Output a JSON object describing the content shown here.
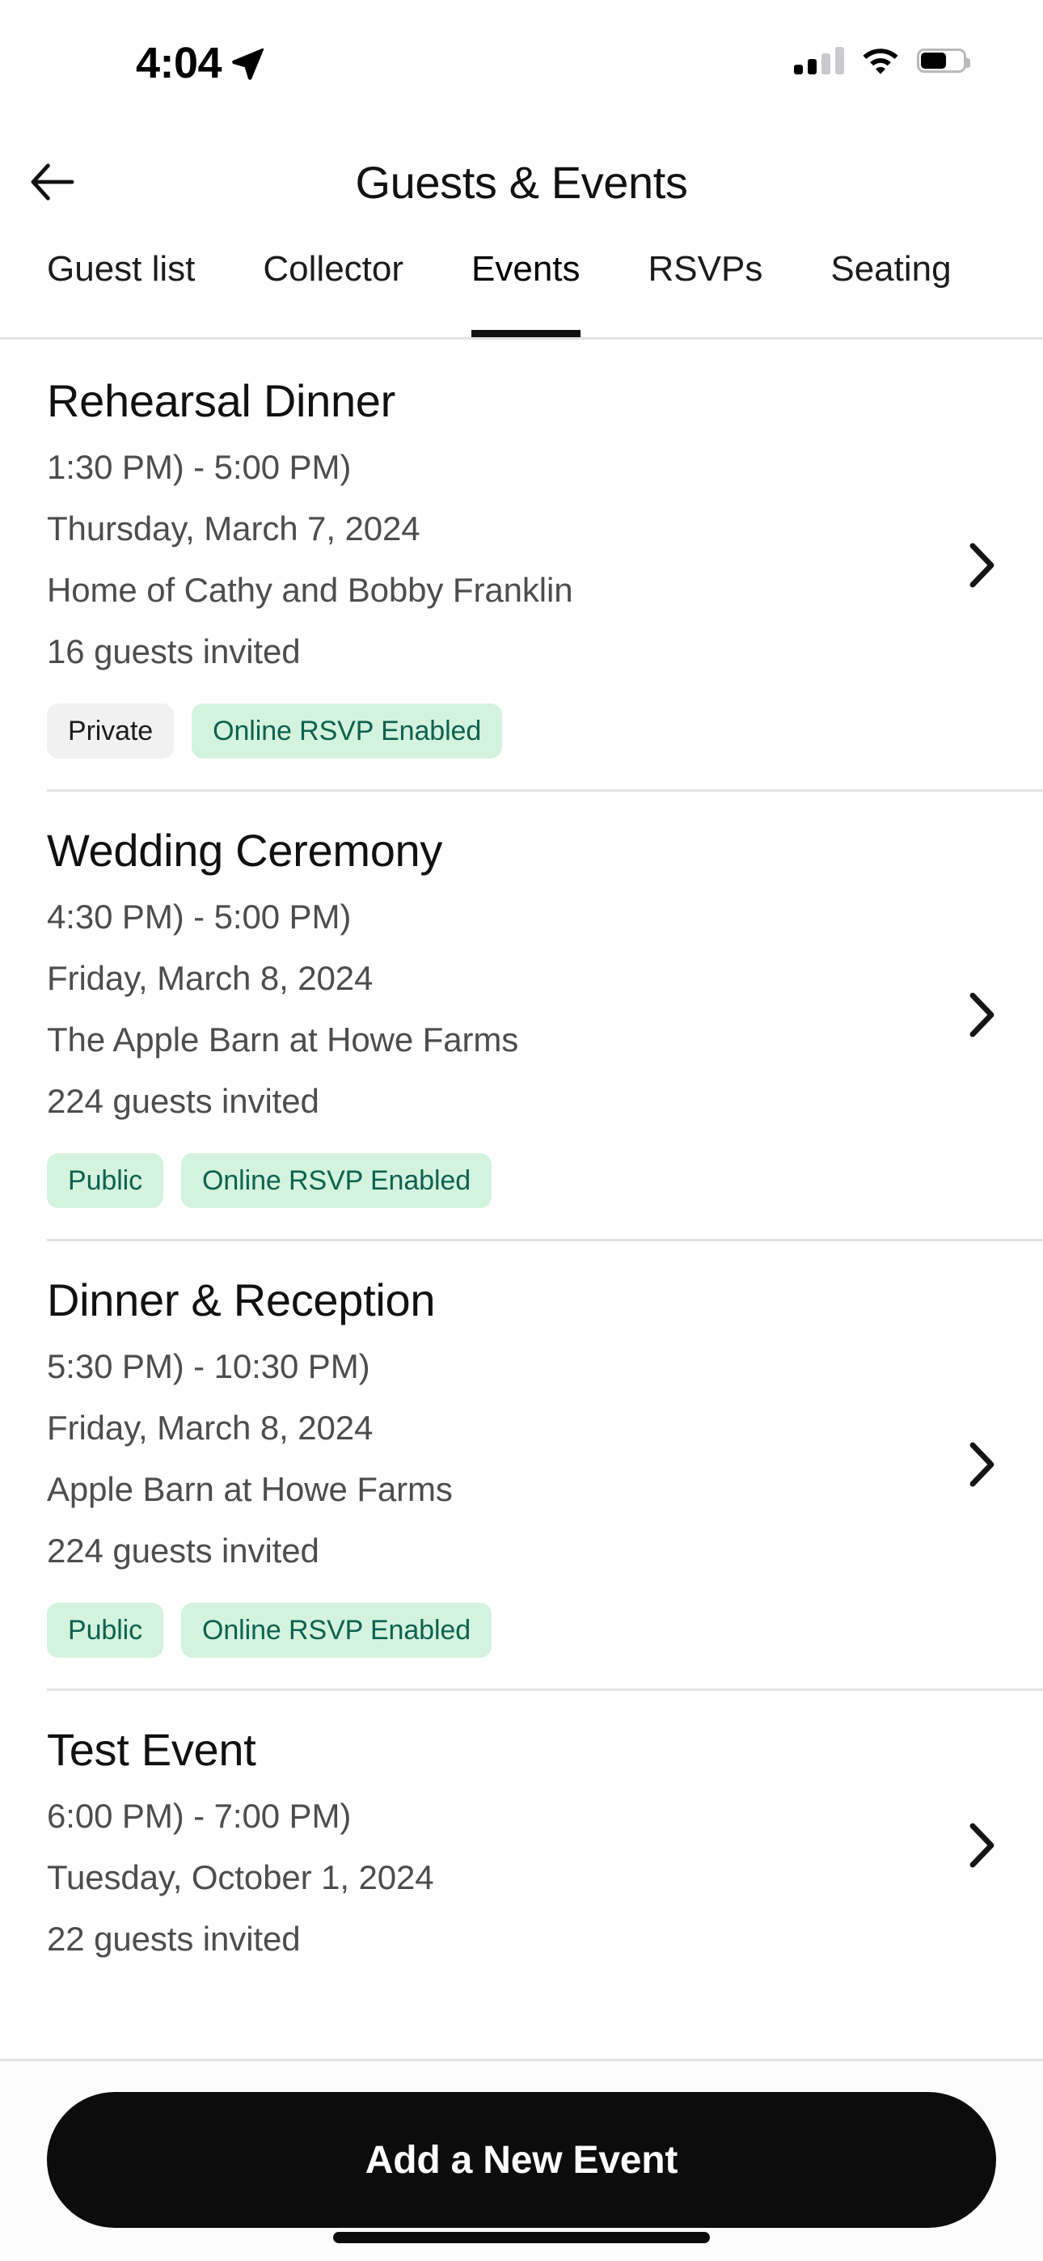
{
  "status_bar": {
    "time": "4:04",
    "location_icon": "location-arrow-icon",
    "signal_icon": "cellular-signal-icon",
    "signal_bars_filled": 2,
    "signal_bars_total": 4,
    "wifi_icon": "wifi-icon",
    "battery_icon": "battery-icon",
    "battery_level_percent": 60
  },
  "header": {
    "back_icon": "arrow-left-icon",
    "title": "Guests & Events"
  },
  "tabs": {
    "active": "Events",
    "items": [
      {
        "label": "Guest list"
      },
      {
        "label": "Collector"
      },
      {
        "label": "Events"
      },
      {
        "label": "RSVPs"
      },
      {
        "label": "Seating"
      }
    ]
  },
  "events": [
    {
      "title": "Rehearsal Dinner",
      "time": "1:30 PM) - 5:00 PM)",
      "date": "Thursday, March 7, 2024",
      "location": "Home of Cathy and Bobby Franklin",
      "guests": "16 guests invited",
      "badges": [
        {
          "label": "Private",
          "style": "neutral"
        },
        {
          "label": "Online RSVP Enabled",
          "style": "green"
        }
      ],
      "chevron_icon": "chevron-right-icon"
    },
    {
      "title": "Wedding Ceremony",
      "time": "4:30 PM) - 5:00 PM)",
      "date": "Friday, March 8, 2024",
      "location": "The Apple Barn at Howe Farms",
      "guests": "224 guests invited",
      "badges": [
        {
          "label": "Public",
          "style": "green"
        },
        {
          "label": "Online RSVP Enabled",
          "style": "green"
        }
      ],
      "chevron_icon": "chevron-right-icon"
    },
    {
      "title": "Dinner & Reception",
      "time": "5:30 PM) - 10:30 PM)",
      "date": "Friday, March 8, 2024",
      "location": "Apple Barn at Howe Farms",
      "guests": "224 guests invited",
      "badges": [
        {
          "label": "Public",
          "style": "green"
        },
        {
          "label": "Online RSVP Enabled",
          "style": "green"
        }
      ],
      "chevron_icon": "chevron-right-icon"
    },
    {
      "title": "Test Event",
      "time": "6:00 PM) - 7:00 PM)",
      "date": "Tuesday, October 1, 2024",
      "location": null,
      "guests": "22 guests invited",
      "badges": [],
      "chevron_icon": "chevron-right-icon"
    }
  ],
  "bottom_bar": {
    "cta_label": "Add a New Event",
    "home_indicator": "home-indicator"
  },
  "colors": {
    "accent": "#0c0c0c",
    "badge_green_bg": "#d4f3de",
    "badge_green_text": "#0d6150",
    "badge_neutral_bg": "#f1f1f1",
    "divider": "#e2e2e2",
    "secondary_text": "#4d4d4d"
  }
}
